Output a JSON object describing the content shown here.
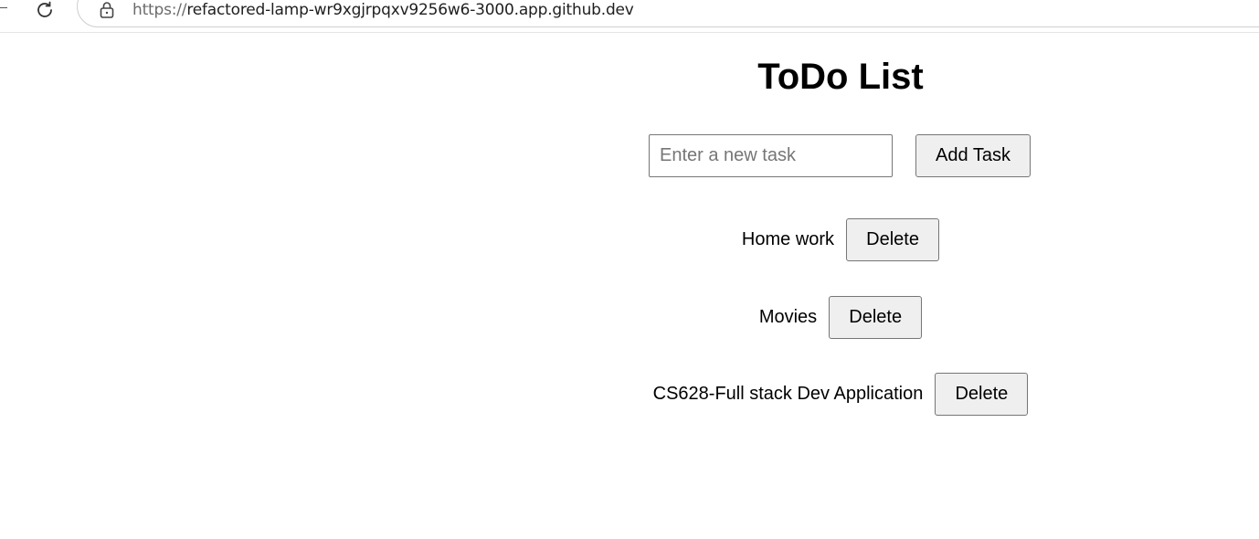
{
  "browser": {
    "url_scheme": "https://",
    "url_rest": "refactored-lamp-wr9xgjrpqxv9256w6-3000.app.github.dev"
  },
  "app": {
    "title": "ToDo List",
    "input_placeholder": "Enter a new task",
    "add_button_label": "Add Task",
    "tasks": [
      {
        "label": "Home work",
        "delete_label": "Delete"
      },
      {
        "label": "Movies",
        "delete_label": "Delete"
      },
      {
        "label": "CS628-Full stack Dev Application",
        "delete_label": "Delete"
      }
    ]
  }
}
